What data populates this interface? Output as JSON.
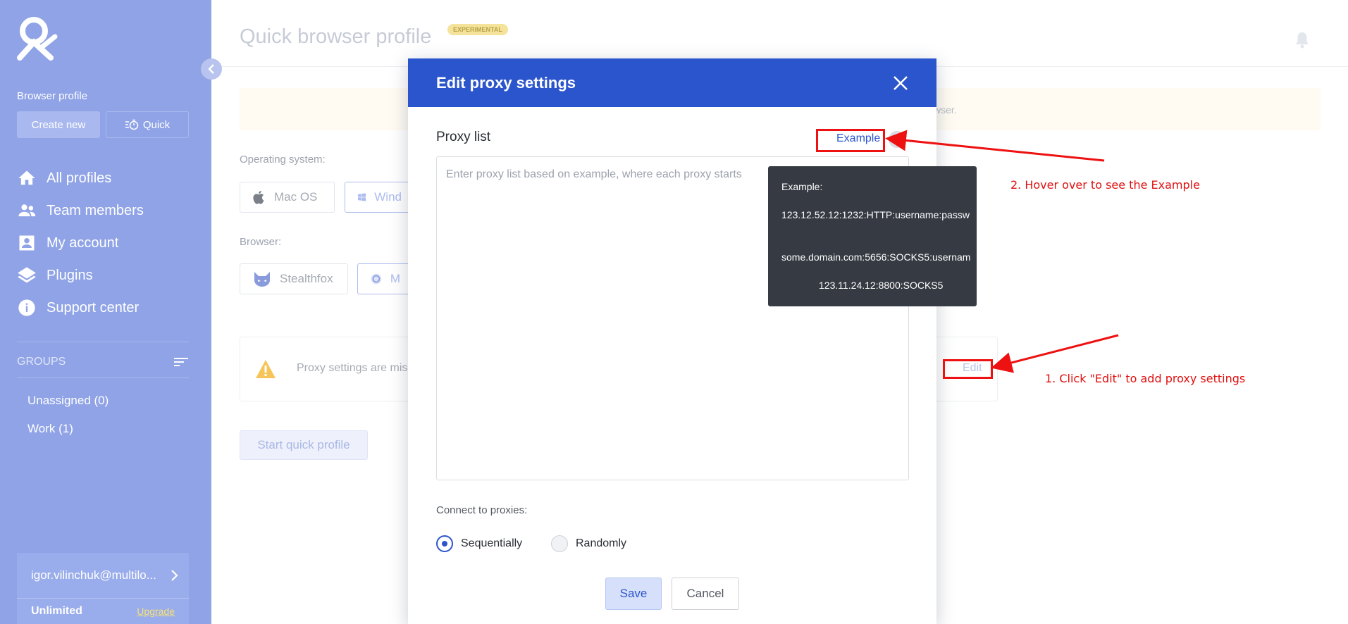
{
  "sidebar": {
    "section_label": "Browser profile",
    "create_label": "Create new",
    "quick_label": "Quick",
    "nav": [
      {
        "label": "All profiles",
        "icon": "home-icon"
      },
      {
        "label": "Team members",
        "icon": "team-icon"
      },
      {
        "label": "My account",
        "icon": "account-icon"
      },
      {
        "label": "Plugins",
        "icon": "layers-icon"
      },
      {
        "label": "Support center",
        "icon": "info-icon"
      }
    ],
    "groups_title": "GROUPS",
    "groups": [
      {
        "label": "Unassigned  (0)"
      },
      {
        "label": "Work  (1)"
      }
    ],
    "user_email": "igor.vilinchuk@multilo...",
    "plan": "Unlimited",
    "upgrade_label": "Upgrade"
  },
  "main": {
    "title": "Quick browser profile",
    "badge": "EXPERIMENTAL",
    "notice_text": "wser.",
    "os_label": "Operating system:",
    "os_options": [
      {
        "label": "Mac OS"
      },
      {
        "label": "Wind"
      }
    ],
    "browser_label": "Browser:",
    "browser_options": [
      {
        "label": "Stealthfox"
      },
      {
        "label": "M"
      }
    ],
    "proxy_missing": "Proxy settings are mis",
    "edit_label": "Edit",
    "start_label": "Start quick profile"
  },
  "modal": {
    "title": "Edit proxy settings",
    "proxy_list_label": "Proxy list",
    "example_label": "Example",
    "textarea_placeholder": "Enter proxy list based on example, where each proxy starts",
    "connect_label": "Connect to proxies:",
    "radio_sequential": "Sequentially",
    "radio_random": "Randomly",
    "selected_mode": "Sequentially",
    "save_label": "Save",
    "cancel_label": "Cancel"
  },
  "tooltip": {
    "heading": "Example:",
    "line1": "123.12.52.12:1232:HTTP:username:passw",
    "line2": "some.domain.com:5656:SOCKS5:usernam",
    "line3": "123.11.24.12:8800:SOCKS5"
  },
  "annotations": {
    "hover_note": "2. Hover over to see the Example",
    "click_note": "1. Click \"Edit\" to add proxy settings"
  },
  "colors": {
    "sidebar": "#8fa3e6",
    "modal_header": "#2b55cc",
    "annotation": "#ee1111",
    "tooltip_bg": "#363a42"
  }
}
